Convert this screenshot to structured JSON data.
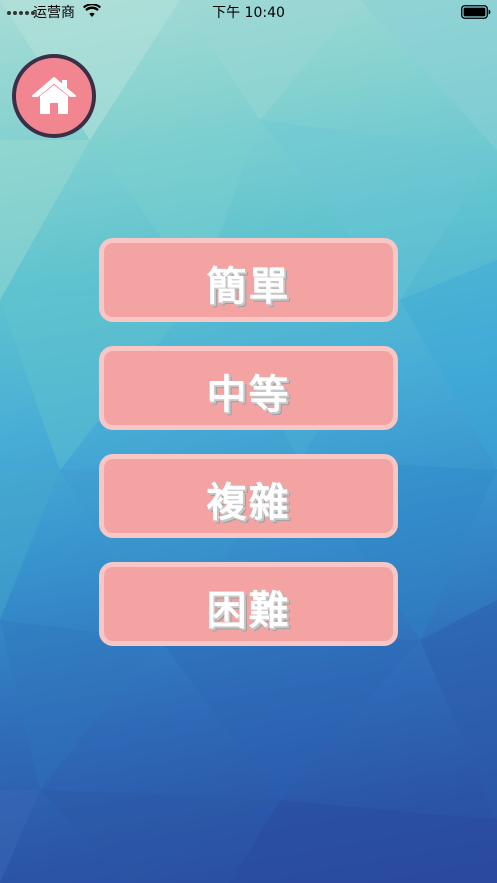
{
  "status_bar": {
    "carrier": "运营商",
    "time": "下午 10:40"
  },
  "home_button": {
    "icon": "home-icon"
  },
  "menu": {
    "buttons": [
      {
        "label": "簡單"
      },
      {
        "label": "中等"
      },
      {
        "label": "複雜"
      },
      {
        "label": "困難"
      }
    ]
  },
  "colors": {
    "button_fill": "#f3a4a2",
    "button_border": "#f8c6c4",
    "home_fill": "#f18691",
    "home_border": "#3a2f47"
  }
}
